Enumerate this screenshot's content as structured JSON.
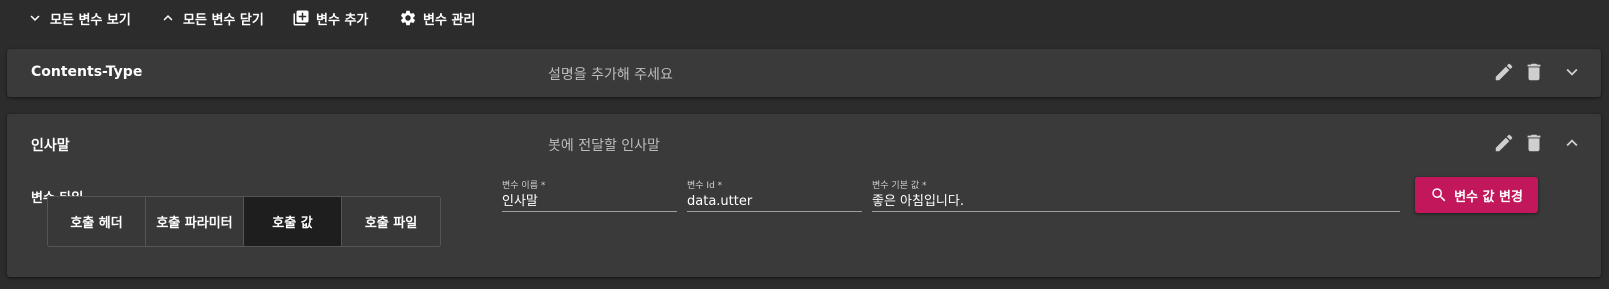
{
  "toolbar": {
    "expand_all": "모든 변수 보기",
    "collapse_all": "모든 변수 닫기",
    "add_variable": "변수 추가",
    "manage_variables": "변수 관리"
  },
  "variables": [
    {
      "name": "Contents-Type",
      "description": "설명을 추가해 주세요",
      "expanded": false
    },
    {
      "name": "인사말",
      "description": "봇에 전달할 인사말",
      "expanded": true,
      "type_label": "변수 타입",
      "type_options": [
        "호출 헤더",
        "호출 파라미터",
        "호출 값",
        "호출 파일"
      ],
      "selected_type": "호출 값",
      "fields": {
        "name_label": "변수 이름 *",
        "name_value": "인사말",
        "id_label": "변수 Id *",
        "id_value": "data.utter",
        "default_label": "변수 기본 값 *",
        "default_value": "좋은 아침입니다."
      },
      "change_button": "변수 값 변경"
    }
  ],
  "colors": {
    "background": "#2c2c2c",
    "panel": "#3a3a3a",
    "accent": "#c2185b"
  },
  "icons": [
    "chevron-down-icon",
    "chevron-up-icon",
    "add-box-icon",
    "gear-icon",
    "pencil-icon",
    "trash-icon",
    "search-icon"
  ]
}
